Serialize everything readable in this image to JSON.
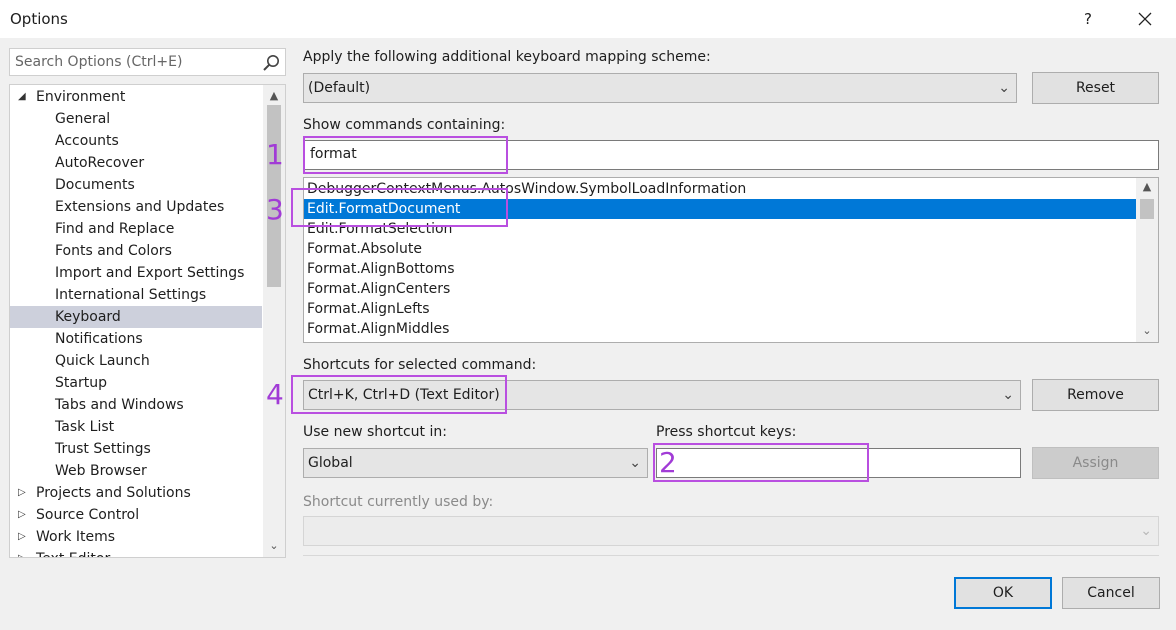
{
  "window": {
    "title": "Options",
    "help_label": "?"
  },
  "search": {
    "placeholder": "Search Options (Ctrl+E)"
  },
  "tree": {
    "items": [
      {
        "label": "Environment",
        "expander": "expanded"
      },
      {
        "label": "General"
      },
      {
        "label": "Accounts"
      },
      {
        "label": "AutoRecover"
      },
      {
        "label": "Documents"
      },
      {
        "label": "Extensions and Updates"
      },
      {
        "label": "Find and Replace"
      },
      {
        "label": "Fonts and Colors"
      },
      {
        "label": "Import and Export Settings"
      },
      {
        "label": "International Settings"
      },
      {
        "label": "Keyboard",
        "selected": true
      },
      {
        "label": "Notifications"
      },
      {
        "label": "Quick Launch"
      },
      {
        "label": "Startup"
      },
      {
        "label": "Tabs and Windows"
      },
      {
        "label": "Task List"
      },
      {
        "label": "Trust Settings"
      },
      {
        "label": "Web Browser"
      },
      {
        "label": "Projects and Solutions",
        "expander": "collapsed"
      },
      {
        "label": "Source Control",
        "expander": "collapsed"
      },
      {
        "label": "Work Items",
        "expander": "collapsed"
      },
      {
        "label": "Text Editor",
        "expander": "collapsed"
      }
    ]
  },
  "mapping": {
    "label": "Apply the following additional keyboard mapping scheme:",
    "value": "(Default)",
    "reset_label": "Reset"
  },
  "commands": {
    "label": "Show commands containing:",
    "filter_value": "format",
    "items": [
      "DebuggerContextMenus.AutosWindow.SymbolLoadInformation",
      "Edit.FormatDocument",
      "Edit.FormatSelection",
      "Format.Absolute",
      "Format.AlignBottoms",
      "Format.AlignCenters",
      "Format.AlignLefts",
      "Format.AlignMiddles"
    ],
    "selected_index": 1
  },
  "shortcuts": {
    "label": "Shortcuts for selected command:",
    "value": "Ctrl+K, Ctrl+D (Text Editor)",
    "remove_label": "Remove"
  },
  "new_shortcut": {
    "scope_label": "Use new shortcut in:",
    "scope_value": "Global",
    "keys_label": "Press shortcut keys:",
    "keys_value": "",
    "assign_label": "Assign"
  },
  "used_by": {
    "label": "Shortcut currently used by:",
    "value": ""
  },
  "footer": {
    "ok_label": "OK",
    "cancel_label": "Cancel"
  },
  "annotations": [
    "1",
    "2",
    "3",
    "4"
  ],
  "colors": {
    "accent": "#0078d7",
    "annotation": "#b94fe0",
    "selection_inactive": "#cdd0dc"
  }
}
